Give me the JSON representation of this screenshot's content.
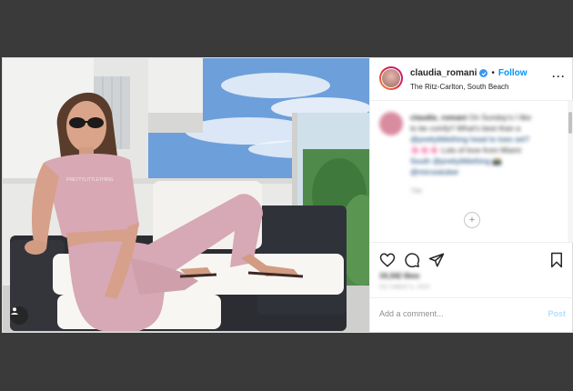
{
  "header": {
    "username": "claudia_romani",
    "follow_label": "Follow",
    "location": "The Ritz-Carlton, South Beach"
  },
  "caption": {
    "username": "claudia_romani",
    "text_line1": "On Sunday's I like",
    "text_line2": "to be comfy!! What's best than a",
    "text_line3": "@prettylittlething head to toes set?",
    "text_line4": "🌸🌸🌸 Lots of love from Miami",
    "text_line5": "South @prettylittlething 📸",
    "text_line6": "@mirceatuber",
    "time": "73w"
  },
  "actions": {
    "likes": "19,342 likes",
    "date": "OCTOBER 5, 2020"
  },
  "comment_box": {
    "placeholder": "Add a comment...",
    "post_label": "Post"
  },
  "icons": {
    "like": "heart-icon",
    "comment": "comment-icon",
    "share": "share-icon",
    "save": "bookmark-icon",
    "tag": "user-tag-icon",
    "verified": "verified-badge-icon",
    "more": "more-options-icon"
  },
  "colors": {
    "follow": "#0095f6",
    "verified": "#3897f0",
    "post_disabled": "#b2dffc"
  }
}
